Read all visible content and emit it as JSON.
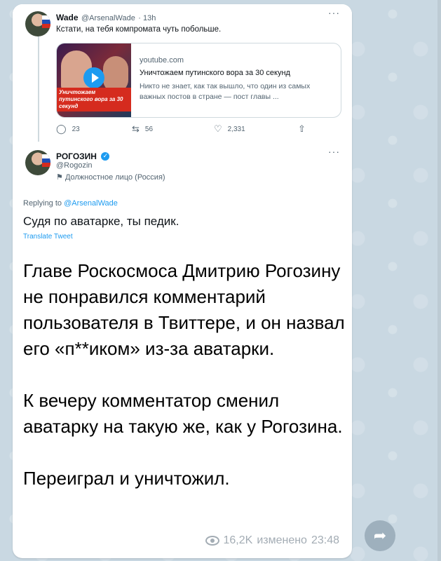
{
  "tweet1": {
    "name": "Wade",
    "handle": "@ArsenalWade",
    "time": "· 13h",
    "text": "Кстати, на тебя компромата чуть побольше.",
    "card": {
      "thumb_caption": "Уничтожаем путинского вора за 30 секунд",
      "domain": "youtube.com",
      "title": "Уничтожаем путинского вора за 30 секунд",
      "description": "Никто не знает, как так вышло, что один из самых важных постов в стране — пост главы ..."
    },
    "stats": {
      "replies": "23",
      "retweets": "56",
      "likes": "2,331"
    }
  },
  "tweet2": {
    "name": "РОГОЗИН",
    "handle": "@Rogozin",
    "affiliation": "Должностное лицо (Россия)",
    "replying_prefix": "Replying to",
    "replying_to": "@ArsenalWade",
    "text": "Судя по аватарке, ты педик.",
    "translate": "Translate Tweet"
  },
  "message": {
    "paragraphs": [
      "Главе Роскосмоса Дмитрию Рогозину не понравился комментарий пользователя в Твиттере, и он назвал его «п**иком» из-за аватарки.",
      "К вечеру комментатор сменил аватарку на такую же, как у Рогозина.",
      "Переиграл и уничтожил."
    ],
    "views": "16,2K",
    "edited_label": "изменено",
    "time": "23:48"
  },
  "icons": {
    "reply": "reply-icon",
    "retweet": "retweet-icon",
    "like": "heart-icon",
    "share": "share-icon",
    "views": "eye-icon",
    "forward": "forward-icon"
  },
  "colors": {
    "accent": "#1d9bf0",
    "background": "#c9d8e2"
  }
}
